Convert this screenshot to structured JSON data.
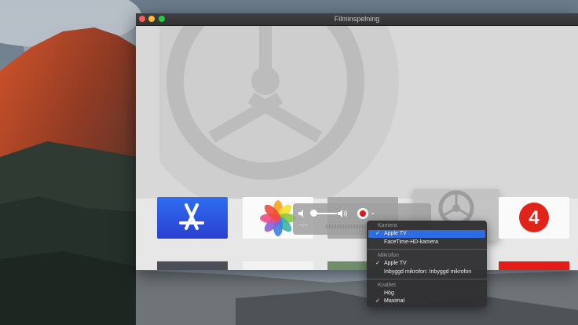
{
  "window": {
    "title": "Filminspelning"
  },
  "hud": {
    "time": "--:--"
  },
  "menu": {
    "sections": [
      {
        "header": "Kamera",
        "items": [
          {
            "label": "Apple TV",
            "checked": true,
            "highlighted": true
          },
          {
            "label": "FaceTime-HD-kamera",
            "checked": false,
            "highlighted": false
          }
        ]
      },
      {
        "header": "Mikrofon",
        "items": [
          {
            "label": "Apple TV",
            "checked": true,
            "highlighted": false
          },
          {
            "label": "Inbyggd mikrofon: Inbyggd mikrofon",
            "checked": false,
            "highlighted": false
          }
        ]
      },
      {
        "header": "Kvalitet",
        "items": [
          {
            "label": "Hög",
            "checked": false,
            "highlighted": false
          },
          {
            "label": "Maximal",
            "checked": true,
            "highlighted": false
          }
        ]
      }
    ],
    "check_glyph": "✓"
  },
  "tiles": {
    "tv4_label": "4"
  },
  "colors": {
    "highlight": "#2d6ce1",
    "record": "#e8141e",
    "close": "#fc5f57",
    "minimize": "#fdbc2e",
    "zoom": "#2ac940"
  }
}
